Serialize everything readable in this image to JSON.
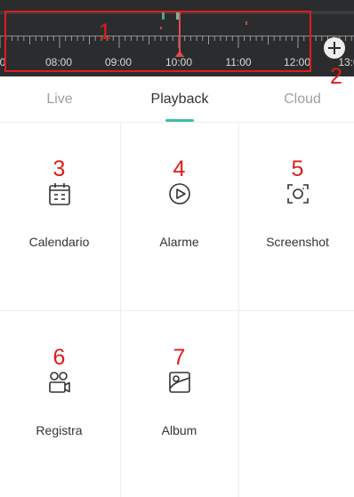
{
  "timeline": {
    "time_labels": [
      "08:00",
      "09:00",
      "10:00",
      "11:00",
      "12:00"
    ],
    "edge_label_left": "0",
    "edge_label_right": "13:0",
    "playhead_color": "#e84c4c",
    "zoom_icon": "plus-circle-icon"
  },
  "annotations": {
    "n1": "1",
    "n2": "2",
    "n3": "3",
    "n4": "4",
    "n5": "5",
    "n6": "6",
    "n7": "7",
    "color": "#e11b1b"
  },
  "tabs": [
    {
      "label": "Live",
      "active": false
    },
    {
      "label": "Playback",
      "active": true
    },
    {
      "label": "Cloud",
      "active": false
    }
  ],
  "accent_color": "#3fbfa4",
  "features": [
    {
      "label": "Calendario",
      "icon": "calendar-icon"
    },
    {
      "label": "Alarme",
      "icon": "alarm-play-icon"
    },
    {
      "label": "Screenshot",
      "icon": "screenshot-icon"
    },
    {
      "label": "Registra",
      "icon": "record-video-icon"
    },
    {
      "label": "Album",
      "icon": "album-icon"
    }
  ]
}
